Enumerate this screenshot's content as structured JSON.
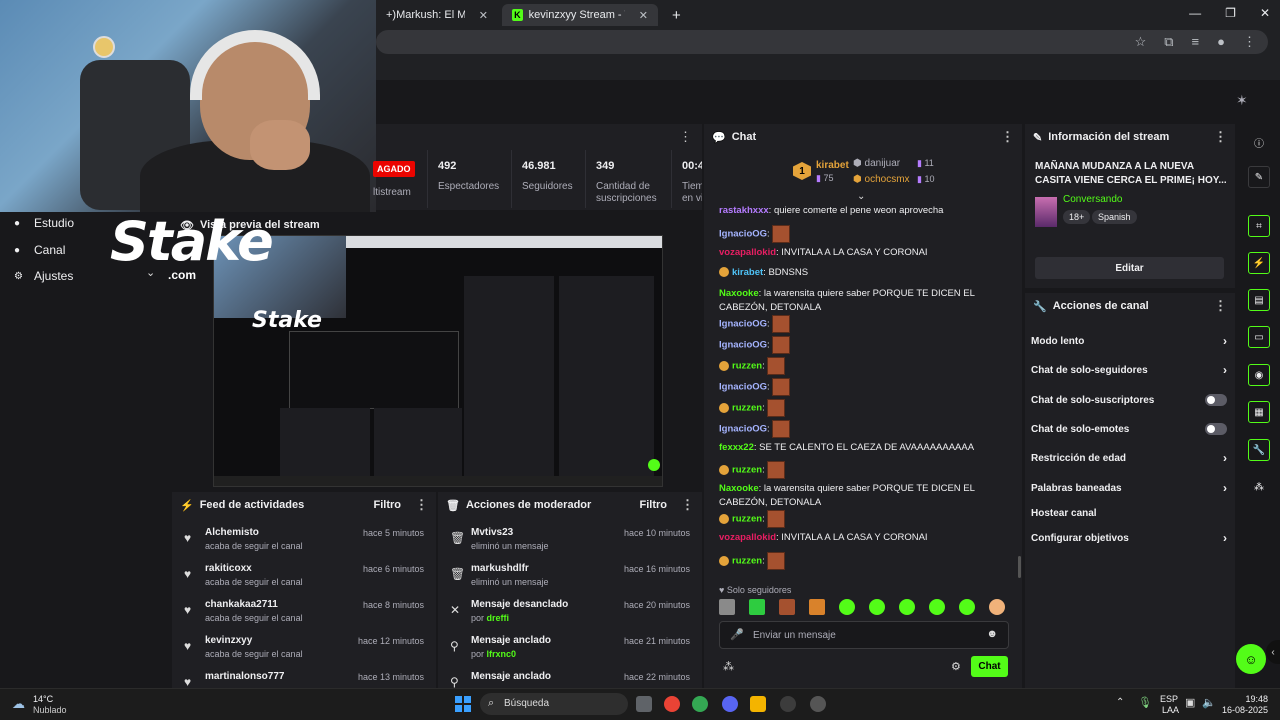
{
  "browser": {
    "tabs": [
      {
        "label": "+)Markush: El Más Caezón d"
      },
      {
        "label": "kevinzxyy Stream - Watch Live o"
      }
    ],
    "tab_close": "✕",
    "new_tab": "+",
    "window_controls": [
      "—",
      "❐",
      "✕"
    ]
  },
  "nav": {
    "items": [
      {
        "label": "Estudio",
        "icon": "gamepad-icon"
      },
      {
        "label": "Canal",
        "icon": "profile-icon"
      },
      {
        "label": "Ajustes",
        "icon": "gear-icon"
      }
    ]
  },
  "overlay": {
    "brand": "Stake",
    "domain": ".com"
  },
  "stats": {
    "paid_badge": "AGADO",
    "multistream_label": "ltistream",
    "items": [
      {
        "value": "492",
        "label": "Espectadores"
      },
      {
        "value": "46.981",
        "label": "Seguidores"
      },
      {
        "value": "349",
        "label": "Cantidad de suscripciones"
      },
      {
        "value": "00:4",
        "label": "Tiem en vi"
      }
    ]
  },
  "preview": {
    "title": "Vista previa del stream"
  },
  "feed": {
    "title": "Feed de actividades",
    "filter": "Filtro",
    "rows": [
      {
        "name": "Alchemisto",
        "desc": "acaba de seguir el canal",
        "time": "hace 5 minutos"
      },
      {
        "name": "rakiticoxx",
        "desc": "acaba de seguir el canal",
        "time": "hace 6 minutos"
      },
      {
        "name": "chankakaa2711",
        "desc": "acaba de seguir el canal",
        "time": "hace 8 minutos"
      },
      {
        "name": "kevinzxyy",
        "desc": "acaba de seguir el canal",
        "time": "hace 12 minutos"
      },
      {
        "name": "martinalonso777",
        "desc": "",
        "time": "hace 13 minutos"
      }
    ]
  },
  "modactions": {
    "title": "Acciones de moderador",
    "filter": "Filtro",
    "rows": [
      {
        "name": "Mvtivs23",
        "desc": "eliminó un mensaje",
        "by": "",
        "time": "hace 10 minutos"
      },
      {
        "name": "markushdlfr",
        "desc": "eliminó un mensaje",
        "by": "",
        "time": "hace 16 minutos"
      },
      {
        "name": "Mensaje desanclado",
        "desc": "por ",
        "by": "dreffi",
        "time": "hace 20 minutos"
      },
      {
        "name": "Mensaje anclado",
        "desc": "por ",
        "by": "lfrxnc0",
        "time": "hace 21 minutos"
      },
      {
        "name": "Mensaje anclado",
        "desc": "",
        "by": "",
        "time": "hace 22 minutos"
      }
    ]
  },
  "chat": {
    "title": "Chat",
    "leaderboard": {
      "rank": "1",
      "first": {
        "name": "kirabet",
        "count": "75"
      },
      "second": {
        "name": "danijuar",
        "count": "11"
      },
      "third": {
        "name": "ochocsmx",
        "count": "10"
      }
    },
    "messages": [
      {
        "user": "rastakhxxx",
        "color": "#b57cff",
        "text": "quiere comerte el pene weon aprovecha"
      },
      {
        "user": "IgnacioOG",
        "color": "#a5b4ff",
        "text": "",
        "emote": true
      },
      {
        "user": "vozapallokid",
        "color": "#e91e63",
        "text": "INVITALA A LA CASA Y CORONAI"
      },
      {
        "user": "kirabet",
        "color": "#4fc3f7",
        "text": "BDNSNS",
        "badge": true
      },
      {
        "user": "Naxooke",
        "color": "#53fc18",
        "text": "la warensita quiere saber PORQUE TE DICEN EL CABEZÓN, DETONALA"
      },
      {
        "user": "IgnacioOG",
        "color": "#a5b4ff",
        "text": "",
        "emote": true
      },
      {
        "user": "IgnacioOG",
        "color": "#a5b4ff",
        "text": "",
        "emote": true
      },
      {
        "user": "ruzzen",
        "color": "#53fc18",
        "text": "",
        "emote": true,
        "badge": true
      },
      {
        "user": "IgnacioOG",
        "color": "#a5b4ff",
        "text": "",
        "emote": true
      },
      {
        "user": "ruzzen",
        "color": "#53fc18",
        "text": "",
        "emote": true,
        "badge": true
      },
      {
        "user": "IgnacioOG",
        "color": "#a5b4ff",
        "text": "",
        "emote": true
      },
      {
        "user": "fexxx22",
        "color": "#53fc18",
        "text": "SE TE CALENTO EL CAEZA DE AVAAAAAAAAAA"
      },
      {
        "user": "ruzzen",
        "color": "#53fc18",
        "text": "",
        "emote": true,
        "badge": true
      },
      {
        "user": "Naxooke",
        "color": "#53fc18",
        "text": "la warensita quiere saber PORQUE TE DICEN EL CABEZÓN, DETONALA"
      },
      {
        "user": "ruzzen",
        "color": "#53fc18",
        "text": "",
        "emote": true,
        "badge": true
      },
      {
        "user": "vozapallokid",
        "color": "#e91e63",
        "text": "INVITALA A LA CASA Y CORONAI"
      },
      {
        "user": "ruzzen",
        "color": "#53fc18",
        "text": "",
        "emote": true,
        "badge": true
      }
    ],
    "followers_only": "Solo seguidores",
    "input_placeholder": "Enviar un mensaje",
    "send_label": "Chat"
  },
  "info": {
    "title": "Información del stream",
    "stream_title": "MAÑANA MUDANZA A LA NUEVA CASITA VIENE CERCA EL PRIME¡ HOY...",
    "category": "Conversando",
    "tags": [
      "18+",
      "Spanish"
    ],
    "edit_label": "Editar"
  },
  "actions": {
    "title": "Acciones de canal",
    "rows": [
      {
        "label": "Modo lento",
        "kind": "chevron"
      },
      {
        "label": "Chat de solo-seguidores",
        "kind": "chevron"
      },
      {
        "label": "Chat de solo-suscriptores",
        "kind": "toggle"
      },
      {
        "label": "Chat de solo-emotes",
        "kind": "toggle"
      },
      {
        "label": "Restricción de edad",
        "kind": "chevron"
      },
      {
        "label": "Palabras baneadas",
        "kind": "chevron"
      },
      {
        "label": "Hostear canal",
        "kind": "none"
      },
      {
        "label": "Configurar objetivos",
        "kind": "chevron"
      }
    ]
  },
  "taskbar": {
    "weather_temp": "14°C",
    "weather_desc": "Nublado",
    "search": "Búsqueda",
    "lang": "ESP",
    "lang_sub": "LAA",
    "time": "19:48",
    "date": "16-08-2025"
  },
  "colors": {
    "accent": "#53fc18",
    "panel": "#1f1f23",
    "bg": "#18181b"
  }
}
